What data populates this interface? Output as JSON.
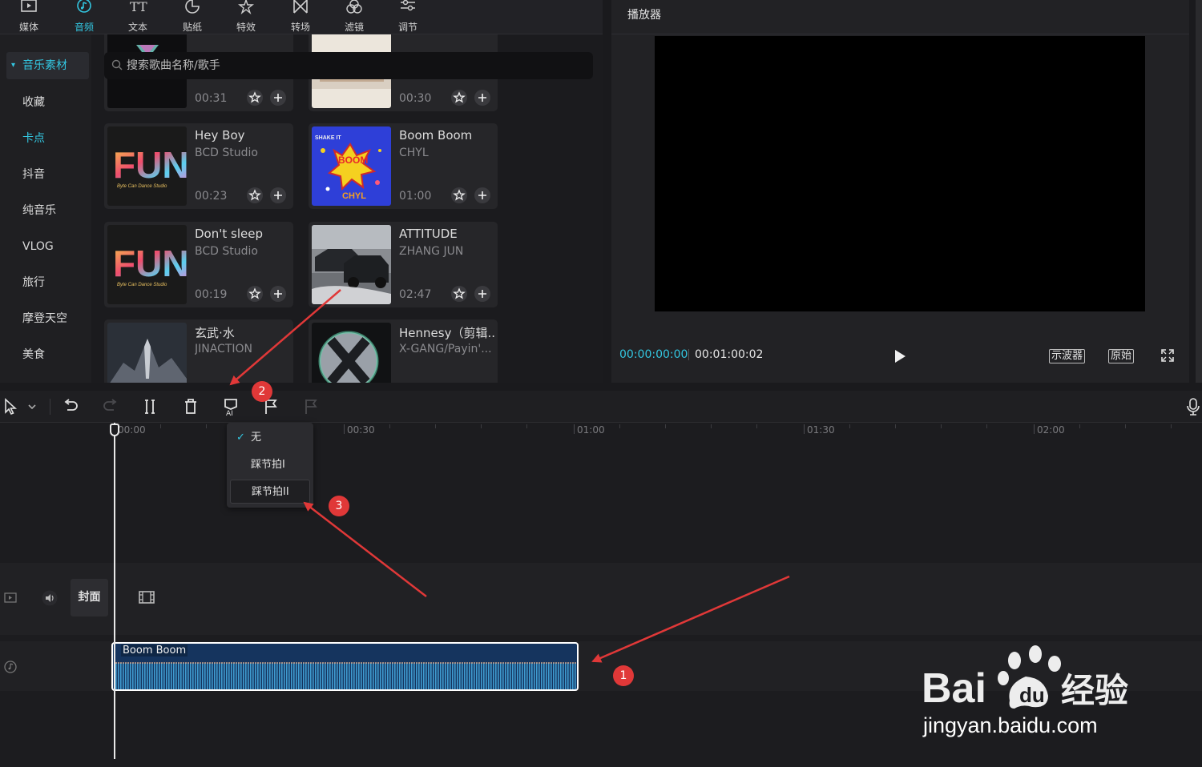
{
  "toolbar": {
    "tabs": [
      {
        "label": "媒体",
        "icon": "media-icon"
      },
      {
        "label": "音频",
        "icon": "audio-icon"
      },
      {
        "label": "文本",
        "icon": "text-icon"
      },
      {
        "label": "贴纸",
        "icon": "sticker-icon"
      },
      {
        "label": "特效",
        "icon": "effects-icon"
      },
      {
        "label": "转场",
        "icon": "transition-icon"
      },
      {
        "label": "滤镜",
        "icon": "filter-icon"
      },
      {
        "label": "调节",
        "icon": "adjust-icon"
      }
    ],
    "active": "音频"
  },
  "sidebar": {
    "items": [
      {
        "label": "音乐素材"
      },
      {
        "label": "收藏"
      },
      {
        "label": "卡点"
      },
      {
        "label": "抖音"
      },
      {
        "label": "纯音乐"
      },
      {
        "label": "VLOG"
      },
      {
        "label": "旅行"
      },
      {
        "label": "摩登天空"
      },
      {
        "label": "美食"
      }
    ]
  },
  "search": {
    "placeholder": "搜索歌曲名称/歌手"
  },
  "songs": [
    {
      "title": "",
      "artist": "",
      "duration": "00:31"
    },
    {
      "title": "",
      "artist": "",
      "duration": "00:30"
    },
    {
      "title": "Hey Boy",
      "artist": "BCD Studio",
      "duration": "00:23"
    },
    {
      "title": "Boom Boom",
      "artist": "CHYL",
      "duration": "01:00"
    },
    {
      "title": "Don't sleep",
      "artist": "BCD Studio",
      "duration": "00:19"
    },
    {
      "title": "ATTITUDE",
      "artist": "ZHANG JUN",
      "duration": "02:47"
    },
    {
      "title": "玄武·水",
      "artist": "JINACTION",
      "duration": ""
    },
    {
      "title": "Hennesy（剪辑...",
      "artist": "X-GANG/Payin'...",
      "duration": ""
    }
  ],
  "thumb_text": {
    "fun": "FUN",
    "fun_sub": "Byte Can Dance Studio",
    "boom": "BOOM",
    "boom_sub": "CHYL",
    "shake": "SHAKE IT"
  },
  "player": {
    "title": "播放器",
    "current_time": "00:00:00:00",
    "total_time": "00:01:00:02",
    "oscilloscope_label": "示波器",
    "original_label": "原始"
  },
  "timeline": {
    "ruler": [
      "00:00",
      "00:30",
      "01:00",
      "01:30",
      "02:00"
    ],
    "cover_label": "封面",
    "clip_name": "Boom Boom"
  },
  "beat_menu": {
    "items": [
      "无",
      "踩节拍I",
      "踩节拍II"
    ],
    "selected": "无"
  },
  "annotations": [
    "1",
    "2",
    "3"
  ],
  "watermark": {
    "brand": "Bai",
    "brand_cn": "经验",
    "domain": "jingyan.baidu.com"
  },
  "colors": {
    "accent": "#33c6e0",
    "clip": "#15345e",
    "marker": "#e03838"
  }
}
